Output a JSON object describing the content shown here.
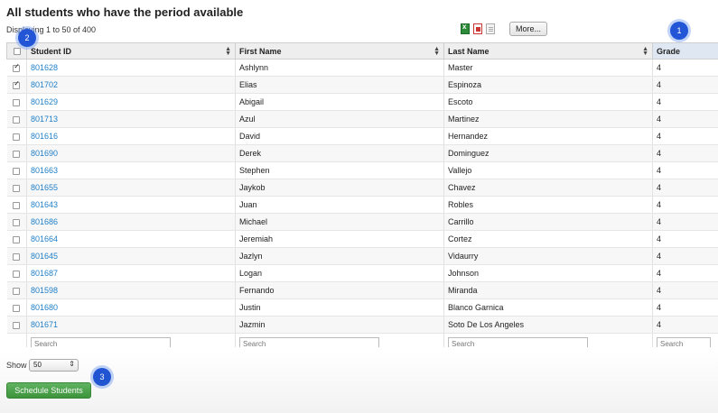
{
  "page": {
    "title": "All students who have the period available",
    "display_count": "Displaying 1 to 50 of 400"
  },
  "toolbar": {
    "excel_icon": "excel-icon",
    "pdf_icon": "pdf-icon",
    "doc_icon": "document-icon",
    "more_label": "More..."
  },
  "table": {
    "columns": [
      "Student ID",
      "First Name",
      "Last Name",
      "Grade"
    ],
    "rows": [
      {
        "checked": true,
        "id": "801628",
        "first": "Ashlynn",
        "last": "Master",
        "grade": "4"
      },
      {
        "checked": true,
        "id": "801702",
        "first": "Elias",
        "last": "Espinoza",
        "grade": "4"
      },
      {
        "checked": false,
        "id": "801629",
        "first": "Abigail",
        "last": "Escoto",
        "grade": "4"
      },
      {
        "checked": false,
        "id": "801713",
        "first": "Azul",
        "last": "Martinez",
        "grade": "4"
      },
      {
        "checked": false,
        "id": "801616",
        "first": "David",
        "last": "Hernandez",
        "grade": "4"
      },
      {
        "checked": false,
        "id": "801690",
        "first": "Derek",
        "last": "Dominguez",
        "grade": "4"
      },
      {
        "checked": false,
        "id": "801663",
        "first": "Stephen",
        "last": "Vallejo",
        "grade": "4"
      },
      {
        "checked": false,
        "id": "801655",
        "first": "Jaykob",
        "last": "Chavez",
        "grade": "4"
      },
      {
        "checked": false,
        "id": "801643",
        "first": "Juan",
        "last": "Robles",
        "grade": "4"
      },
      {
        "checked": false,
        "id": "801686",
        "first": "Michael",
        "last": "Carrillo",
        "grade": "4"
      },
      {
        "checked": false,
        "id": "801664",
        "first": "Jeremiah",
        "last": "Cortez",
        "grade": "4"
      },
      {
        "checked": false,
        "id": "801645",
        "first": "Jazlyn",
        "last": "Vidaurry",
        "grade": "4"
      },
      {
        "checked": false,
        "id": "801687",
        "first": "Logan",
        "last": "Johnson",
        "grade": "4"
      },
      {
        "checked": false,
        "id": "801598",
        "first": "Fernando",
        "last": "Miranda",
        "grade": "4"
      },
      {
        "checked": false,
        "id": "801680",
        "first": "Justin",
        "last": "Blanco Garnica",
        "grade": "4"
      },
      {
        "checked": false,
        "id": "801671",
        "first": "Jazmin",
        "last": "Soto De Los Angeles",
        "grade": "4"
      }
    ],
    "search_placeholder": "Search"
  },
  "footer": {
    "show_label": "Show",
    "show_value": "50",
    "schedule_label": "Schedule Students"
  },
  "badges": {
    "one": "1",
    "two": "2",
    "three": "3"
  }
}
